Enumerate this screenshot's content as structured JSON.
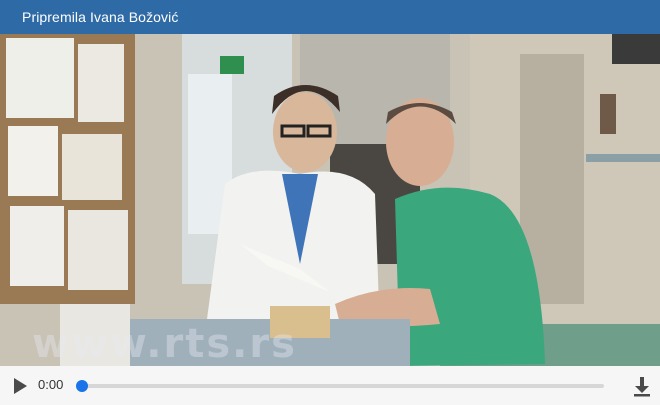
{
  "header": {
    "title": "Pripremila Ivana Božović"
  },
  "video": {
    "watermark": "www.rts.rs"
  },
  "player": {
    "current_time": "0:00",
    "progress_fraction": 0.0,
    "accent_color": "#1a73e8",
    "play_icon": "play-icon",
    "download_icon": "download-icon"
  },
  "colors": {
    "header_bg": "#2d6aa6",
    "controls_bg": "#f6f6f6"
  }
}
